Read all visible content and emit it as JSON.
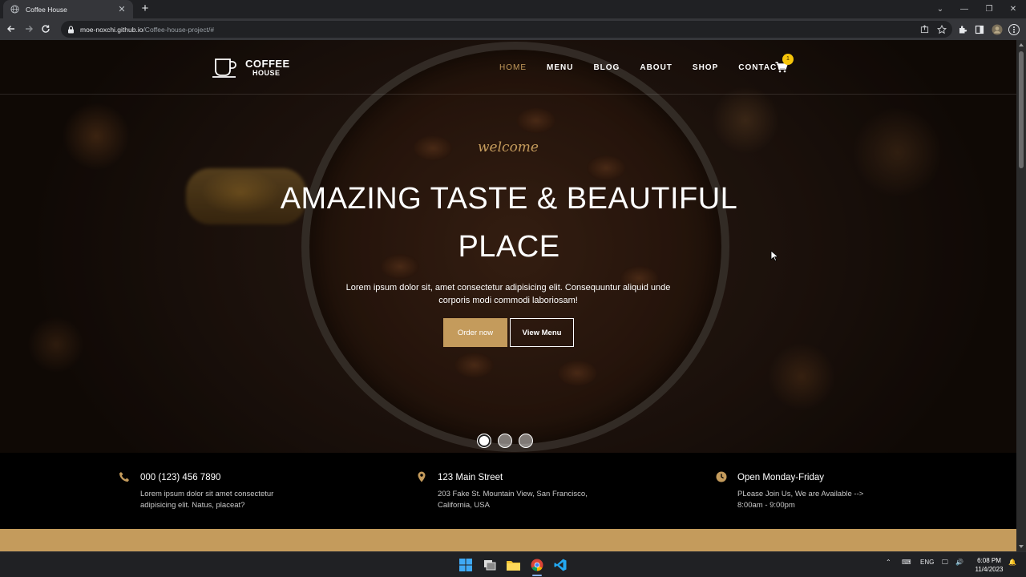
{
  "browser": {
    "tab_title": "Coffee House",
    "url_host": "moe-noxchi.github.io",
    "url_path": "/Coffee-house-project/#"
  },
  "nav": {
    "logo_line1": "COFFEE",
    "logo_line2": "HOUSE",
    "items": [
      {
        "label": "HOME",
        "active": true
      },
      {
        "label": "MENU",
        "active": false
      },
      {
        "label": "BLOG",
        "active": false
      },
      {
        "label": "ABOUT",
        "active": false
      },
      {
        "label": "SHOP",
        "active": false
      },
      {
        "label": "CONTACT",
        "active": false
      }
    ],
    "cart_count": "1"
  },
  "hero": {
    "welcome": "welcome",
    "headline": "AMAZING TASTE & BEAUTIFUL PLACE",
    "description": "Lorem ipsum dolor sit, amet consectetur adipisicing elit. Consequuntur aliquid unde corporis modi commodi laboriosam!",
    "order_button": "Order now",
    "menu_button": "View Menu",
    "slides": 3,
    "active_slide": 1
  },
  "info": [
    {
      "icon": "phone-icon",
      "title": "000 (123) 456 7890",
      "desc": "Lorem ipsum dolor sit amet consectetur adipisicing elit. Natus, placeat?"
    },
    {
      "icon": "map-pin-icon",
      "title": "123 Main Street",
      "desc": "203 Fake St. Mountain View, San Francisco, California, USA"
    },
    {
      "icon": "clock-icon",
      "title": "Open Monday-Friday",
      "desc": "PLease Join Us, We are Available -->\n8:00am - 9:00pm"
    }
  ],
  "taskbar": {
    "language": "ENG",
    "time": "6:08 PM",
    "date": "11/4/2023"
  },
  "colors": {
    "accent": "#c49b5c",
    "badge": "#f5c40a",
    "chrome_dark": "#202124",
    "chrome_toolbar": "#35363a"
  }
}
